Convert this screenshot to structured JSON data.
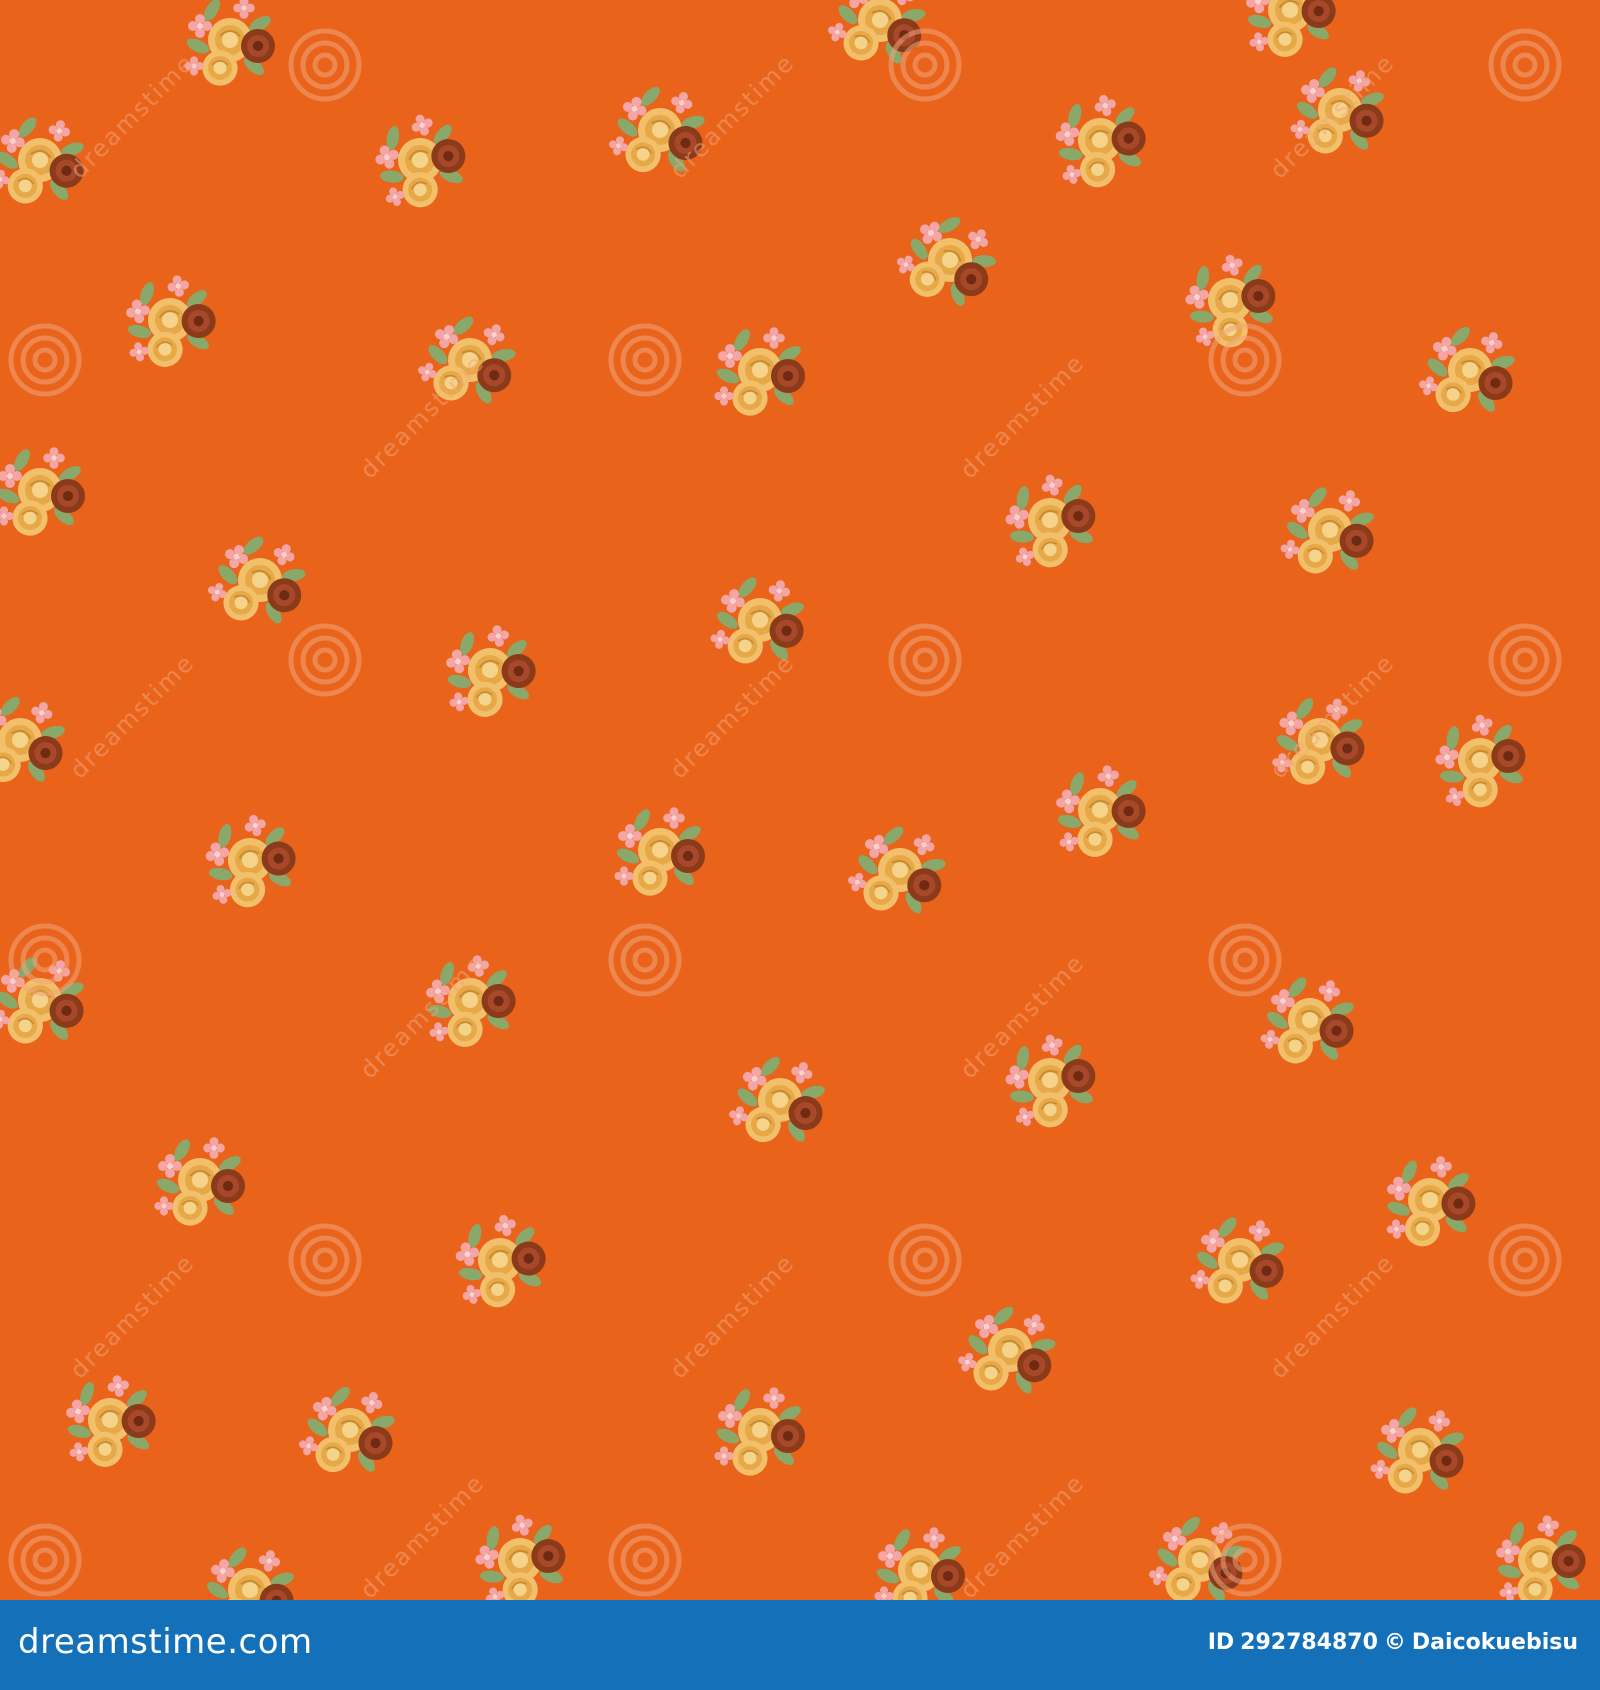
{
  "pattern": {
    "background_color": "#e9631b",
    "motif": "rose-bouquet",
    "flower_colors": [
      "#f2c06a",
      "#e7a948",
      "#8b3a1a",
      "#b25a2a",
      "#f4a6a6",
      "#fbd1cf"
    ],
    "leaf_color": "#8aa86a",
    "watermark_text": "dreamstime",
    "watermark_icon": "spiral-logo-icon"
  },
  "footer": {
    "background_color": "#1471b9",
    "site_name": "dreamstime.com",
    "id_label": "ID",
    "id_value": "292784870",
    "copyright_symbol": "©",
    "author": "Daicokuebisu"
  }
}
